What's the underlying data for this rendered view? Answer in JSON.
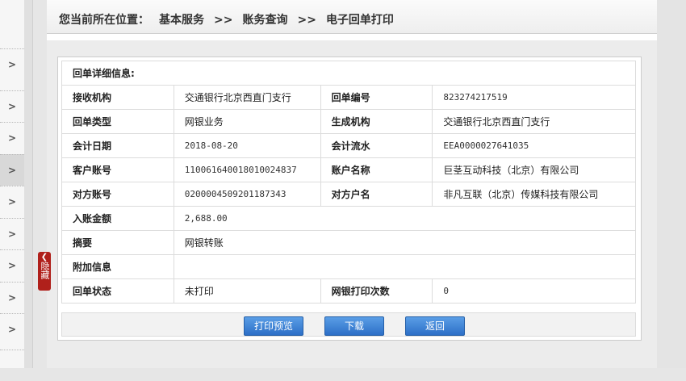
{
  "breadcrumb": {
    "prefix": "您当前所在位置：",
    "level1": "基本服务",
    "sep1": ">>",
    "level2": "账务查询",
    "sep2": ">>",
    "level3": "电子回单打印"
  },
  "sidebar": {
    "hide_label": "隐藏",
    "chevron": ">"
  },
  "detail": {
    "header": "回单详细信息:",
    "rows": [
      {
        "l1": "接收机构",
        "v1": "交通银行北京西直门支行",
        "l2": "回单编号",
        "v2": "823274217519"
      },
      {
        "l1": "回单类型",
        "v1": "网银业务",
        "l2": "生成机构",
        "v2": "交通银行北京西直门支行"
      },
      {
        "l1": "会计日期",
        "v1": "2018-08-20",
        "l2": "会计流水",
        "v2": "EEA0000027641035"
      },
      {
        "l1": "客户账号",
        "v1": "110061640018010024837",
        "l2": "账户名称",
        "v2": "巨茎互动科技（北京）有限公司"
      },
      {
        "l1": "对方账号",
        "v1": "0200004509201187343",
        "l2": "对方户名",
        "v2": "非凡互联（北京）传媒科技有限公司"
      }
    ],
    "amount_label": "入账金额",
    "amount_value": "2,688.00",
    "summary_label": "摘要",
    "summary_value": "网银转账",
    "extra_label": "附加信息",
    "extra_value": "",
    "status_label": "回单状态",
    "status_value": "未打印",
    "print_count_label": "网银打印次数",
    "print_count_value": "0"
  },
  "buttons": {
    "preview": "打印预览",
    "download": "下载",
    "back": "返回"
  }
}
